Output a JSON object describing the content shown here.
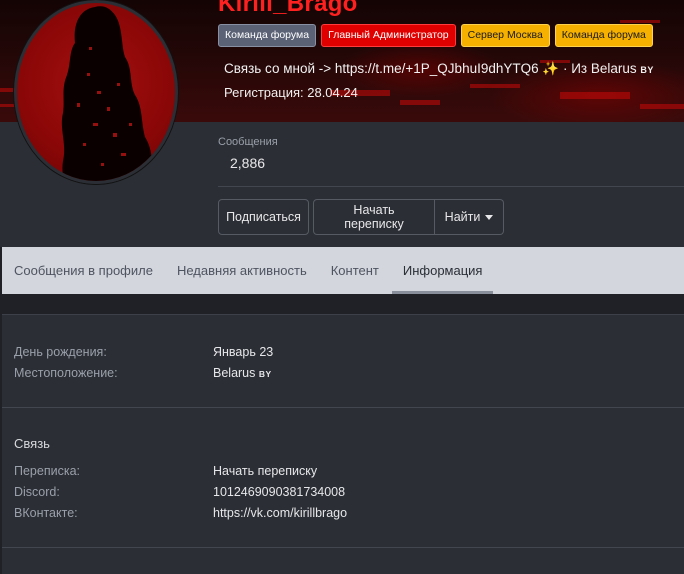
{
  "profile": {
    "username": "Kirill_Brago",
    "badges": [
      "Команда форума",
      "Главный Администратор",
      "Сервер Москва",
      "Команда форума"
    ],
    "about_prefix": "Связь со мной -> https://t.me/+1P_QJbhuI9dhYTQ6",
    "about_spark": "✨",
    "about_suffix": "· Из Belarus",
    "about_country_code": "BY",
    "registration_label": "Регистрация:",
    "registration_date": "28.04.24",
    "messages_label": "Сообщения",
    "messages_count": "2,886"
  },
  "actions": {
    "subscribe": "Подписаться",
    "start_conversation": "Начать переписку",
    "find": "Найти"
  },
  "tabs": [
    {
      "label": "Сообщения в профиле",
      "active": false
    },
    {
      "label": "Недавняя активность",
      "active": false
    },
    {
      "label": "Контент",
      "active": false
    },
    {
      "label": "Информация",
      "active": true
    }
  ],
  "info": {
    "birthday_label": "День рождения:",
    "birthday_value": "Январь 23",
    "location_label": "Местоположение:",
    "location_value": "Belarus",
    "location_code": "BY"
  },
  "contacts": {
    "title": "Связь",
    "conversation_label": "Переписка:",
    "conversation_value": "Начать переписку",
    "discord_label": "Discord:",
    "discord_value": "1012469090381734008",
    "vk_label": "ВКонтакте:",
    "vk_value": "https://vk.com/kirillbrago"
  },
  "colors": {
    "username": "#ff2020",
    "badge_gray": "#5b6275",
    "badge_red": "#e00000",
    "badge_yellow": "#f6b100",
    "tabs_bg": "#d3d6dc",
    "panel_bg": "#2b2e34"
  }
}
